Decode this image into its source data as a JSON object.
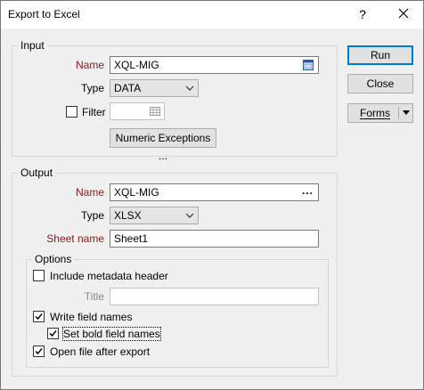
{
  "window": {
    "title": "Export to Excel",
    "help_label": "?"
  },
  "input": {
    "group_label": "Input",
    "name_label": "Name",
    "name_value": "XQL-MIG",
    "type_label": "Type",
    "type_value": "DATA",
    "filter_label": "Filter",
    "filter_checked": false,
    "filter_value": "",
    "numeric_exceptions_label": "Numeric Exceptions ..."
  },
  "output": {
    "group_label": "Output",
    "name_label": "Name",
    "name_value": "XQL-MIG",
    "browse_label": "...",
    "type_label": "Type",
    "type_value": "XLSX",
    "sheet_label": "Sheet name",
    "sheet_value": "Sheet1"
  },
  "options": {
    "group_label": "Options",
    "include_metadata_label": "Include metadata header",
    "include_metadata_checked": false,
    "title_label": "Title",
    "title_value": "",
    "write_field_names_label": "Write field names",
    "write_field_names_checked": true,
    "bold_field_names_label": "Set bold field names",
    "bold_field_names_checked": true,
    "open_after_label": "Open file after export",
    "open_after_checked": true
  },
  "buttons": {
    "run": "Run",
    "close": "Close",
    "forms": "Forms"
  },
  "colors": {
    "required_label": "#8b1a1a",
    "default_button_border": "#0078d7"
  }
}
